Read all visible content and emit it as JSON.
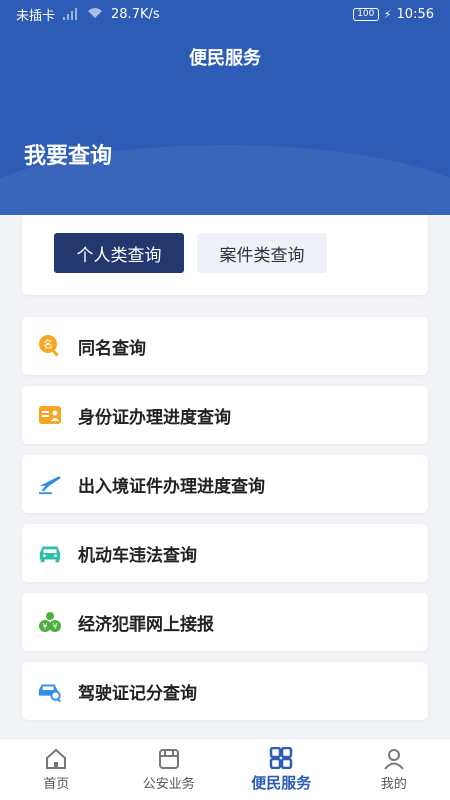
{
  "status_bar": {
    "carrier": "未插卡",
    "speed": "28.7K/s",
    "battery": "100",
    "time": "10:56"
  },
  "header": {
    "title": "便民服务",
    "section_title": "我要查询"
  },
  "tabs": [
    {
      "label": "个人类查询"
    },
    {
      "label": "案件类查询"
    }
  ],
  "items": [
    {
      "label": "同名查询",
      "icon": "name-search-icon"
    },
    {
      "label": "身份证办理进度查询",
      "icon": "id-card-icon"
    },
    {
      "label": "出入境证件办理进度查询",
      "icon": "airplane-icon"
    },
    {
      "label": "机动车违法查询",
      "icon": "car-icon"
    },
    {
      "label": "经济犯罪网上接报",
      "icon": "money-bag-icon"
    },
    {
      "label": "驾驶证记分查询",
      "icon": "car-search-icon"
    }
  ],
  "tabbar": [
    {
      "label": "首页"
    },
    {
      "label": "公安业务"
    },
    {
      "label": "便民服务"
    },
    {
      "label": "我的"
    }
  ],
  "colors": {
    "primary": "#2d5cb6",
    "active_tab": "#23386f",
    "orange": "#f5a623",
    "blue": "#2f8de4",
    "teal": "#2ebfa8",
    "green": "#4cae3c"
  }
}
